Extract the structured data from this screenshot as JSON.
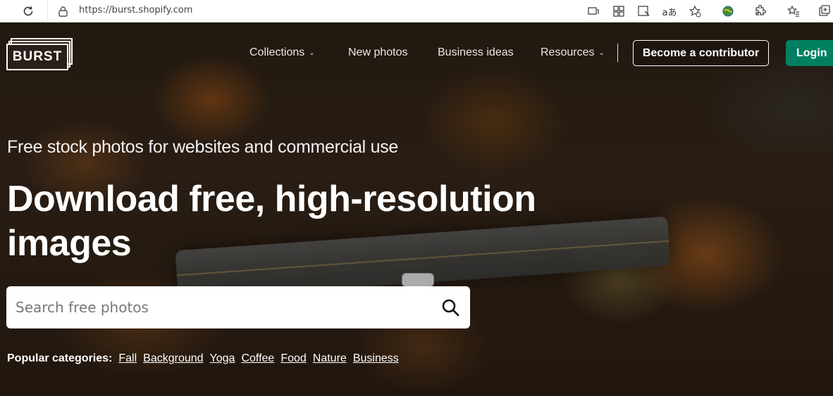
{
  "browser": {
    "url": "https://burst.shopify.com"
  },
  "brand": {
    "logo_text": "BURST"
  },
  "nav": {
    "items": [
      {
        "label": "Collections",
        "has_dropdown": true
      },
      {
        "label": "New photos",
        "has_dropdown": false
      },
      {
        "label": "Business ideas",
        "has_dropdown": false
      },
      {
        "label": "Resources",
        "has_dropdown": true
      }
    ],
    "contributor_button": "Become a contributor",
    "login_button": "Login"
  },
  "hero": {
    "subtitle": "Free stock photos for websites and commercial use",
    "headline": "Download free, high-resolution images"
  },
  "search": {
    "placeholder": "Search free photos"
  },
  "popular": {
    "label": "Popular categories:",
    "categories": [
      "Fall",
      "Background",
      "Yoga",
      "Coffee",
      "Food",
      "Nature",
      "Business"
    ]
  },
  "colors": {
    "brand_green": "#008060"
  }
}
